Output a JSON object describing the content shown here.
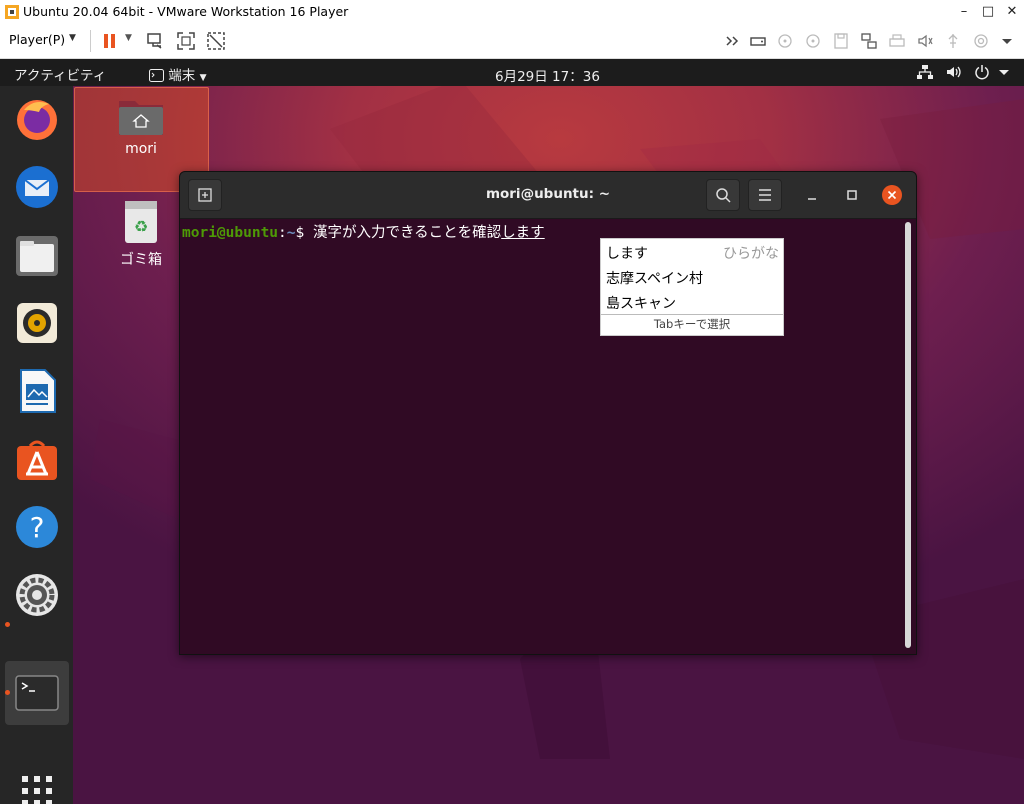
{
  "vmware": {
    "title": "Ubuntu 20.04 64bit - VMware Workstation 16 Player",
    "player_menu": "Player(P)",
    "window_controls": [
      "minimize-icon",
      "maximize-icon",
      "close-icon"
    ],
    "toolbar_icons": [
      "pause-icon",
      "send-ctrl-alt-del-icon",
      "full-screen-icon",
      "unity-icon",
      "forward-icon",
      "hard-disk-icon",
      "cd-dvd-icon",
      "cd-dvd-icon",
      "floppy-icon",
      "network-icon",
      "printer-icon",
      "sound-icon",
      "usb-icon",
      "camera-icon",
      "more-icon"
    ]
  },
  "gnome_topbar": {
    "activities": "アクティビティ",
    "app_menu": "端末",
    "clock": "6月29日  17：36"
  },
  "desktop": {
    "home_label": "mori",
    "trash_label": "ゴミ箱"
  },
  "terminal": {
    "title": "mori@ubuntu: ~",
    "prompt_user": "mori@ubuntu",
    "prompt_sep": ":",
    "prompt_path": "~",
    "prompt_symbol": "$ ",
    "command": "漢字が入力できることを確認",
    "preedit": "します"
  },
  "ime_popup": {
    "hint": "ひらがな",
    "candidates": [
      "します",
      "志摩スペイン村",
      "島スキャン"
    ],
    "footer": "Tabキーで選択"
  },
  "colors": {
    "ubuntu_orange": "#e95420",
    "terminal_bg": "#300a24",
    "prompt_user": "#4e9a06",
    "prompt_path": "#6d8fbf"
  }
}
